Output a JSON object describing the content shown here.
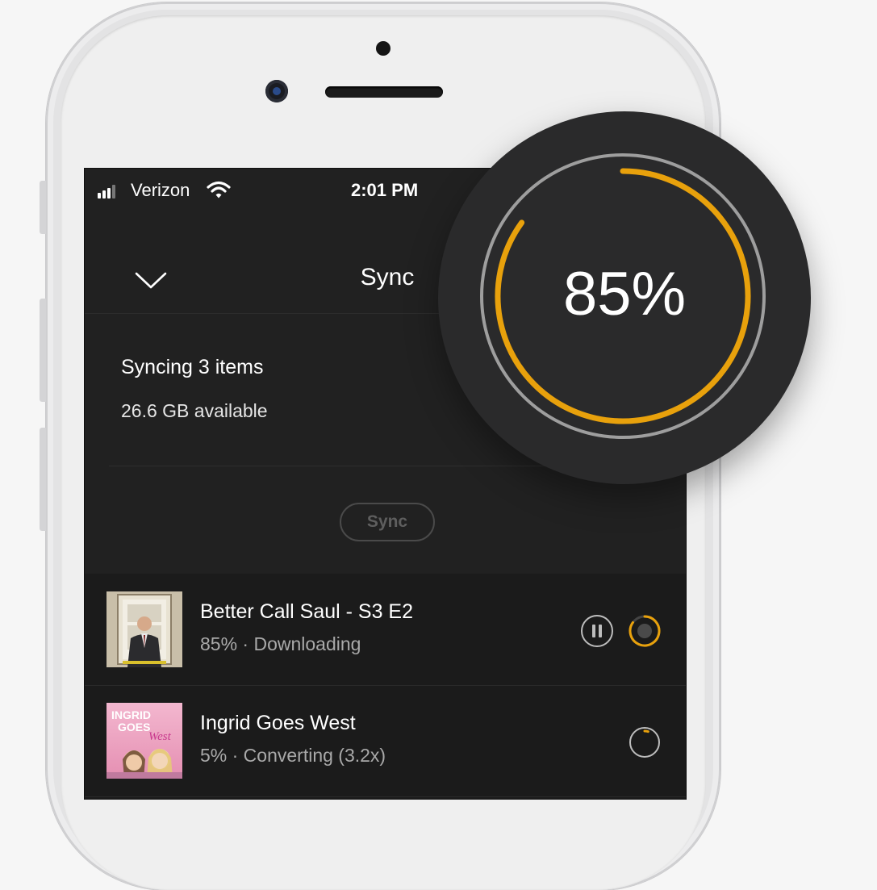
{
  "statusbar": {
    "carrier": "Verizon",
    "time": "2:01 PM",
    "signal_bars": 4,
    "signal_bars_filled": 3
  },
  "header": {
    "title": "Sync",
    "back_icon": "chevron-down-icon"
  },
  "sync_info": {
    "status": "Syncing 3 items",
    "storage": "26.6 GB available",
    "sync_button_label": "Sync"
  },
  "progress_badge": {
    "percent_label": "85%",
    "progress": 0.85,
    "accent_color": "#e8a10c"
  },
  "items": [
    {
      "title": "Better Call Saul - S3 E2",
      "status": "85% · Downloading",
      "progress": 0.85,
      "actions": [
        "pause-icon",
        "progress-ring-icon"
      ]
    },
    {
      "title": "Ingrid Goes West",
      "status": "5% · Converting (3.2x)",
      "progress": 0.05,
      "actions": [
        "progress-ring-icon"
      ],
      "poster_text": [
        "INGRID",
        "GOES",
        "West"
      ]
    }
  ]
}
